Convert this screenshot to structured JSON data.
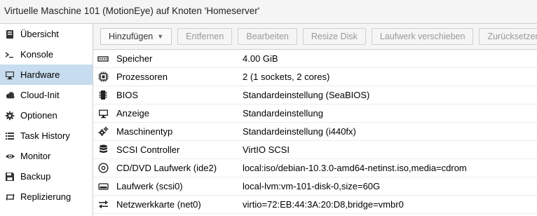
{
  "window": {
    "title": "Virtuelle Maschine 101 (MotionEye) auf Knoten 'Homeserver'"
  },
  "sidebar": {
    "items": [
      {
        "label": "Übersicht",
        "icon": "book-icon"
      },
      {
        "label": "Konsole",
        "icon": "terminal-icon"
      },
      {
        "label": "Hardware",
        "icon": "desktop-icon",
        "active": true
      },
      {
        "label": "Cloud-Init",
        "icon": "cloud-icon"
      },
      {
        "label": "Optionen",
        "icon": "gear-icon"
      },
      {
        "label": "Task History",
        "icon": "list-icon"
      },
      {
        "label": "Monitor",
        "icon": "eye-icon"
      },
      {
        "label": "Backup",
        "icon": "floppy-icon"
      },
      {
        "label": "Replizierung",
        "icon": "retweet-icon"
      }
    ]
  },
  "toolbar": {
    "add_label": "Hinzufügen",
    "remove_label": "Entfernen",
    "edit_label": "Bearbeiten",
    "resize_label": "Resize Disk",
    "move_label": "Laufwerk verschieben",
    "revert_label": "Zurücksetzen"
  },
  "hardware": {
    "rows": [
      {
        "name": "Speicher",
        "value": "4.00 GiB",
        "icon": "memory-icon"
      },
      {
        "name": "Prozessoren",
        "value": "2 (1 sockets, 2 cores)",
        "icon": "cpu-icon"
      },
      {
        "name": "BIOS",
        "value": "Standardeinstellung (SeaBIOS)",
        "icon": "microchip-icon"
      },
      {
        "name": "Anzeige",
        "value": "Standardeinstellung",
        "icon": "monitor-icon"
      },
      {
        "name": "Maschinentyp",
        "value": "Standardeinstellung (i440fx)",
        "icon": "cogs-icon"
      },
      {
        "name": "SCSI Controller",
        "value": "VirtIO SCSI",
        "icon": "database-icon"
      },
      {
        "name": "CD/DVD Laufwerk (ide2)",
        "value": "local:iso/debian-10.3.0-amd64-netinst.iso,media=cdrom",
        "icon": "cdrom-icon"
      },
      {
        "name": "Laufwerk (scsi0)",
        "value": "local-lvm:vm-101-disk-0,size=60G",
        "icon": "hdd-icon"
      },
      {
        "name": "Netzwerkkarte (net0)",
        "value": "virtio=72:EB:44:3A:20:D8,bridge=vmbr0",
        "icon": "exchange-icon"
      }
    ]
  }
}
